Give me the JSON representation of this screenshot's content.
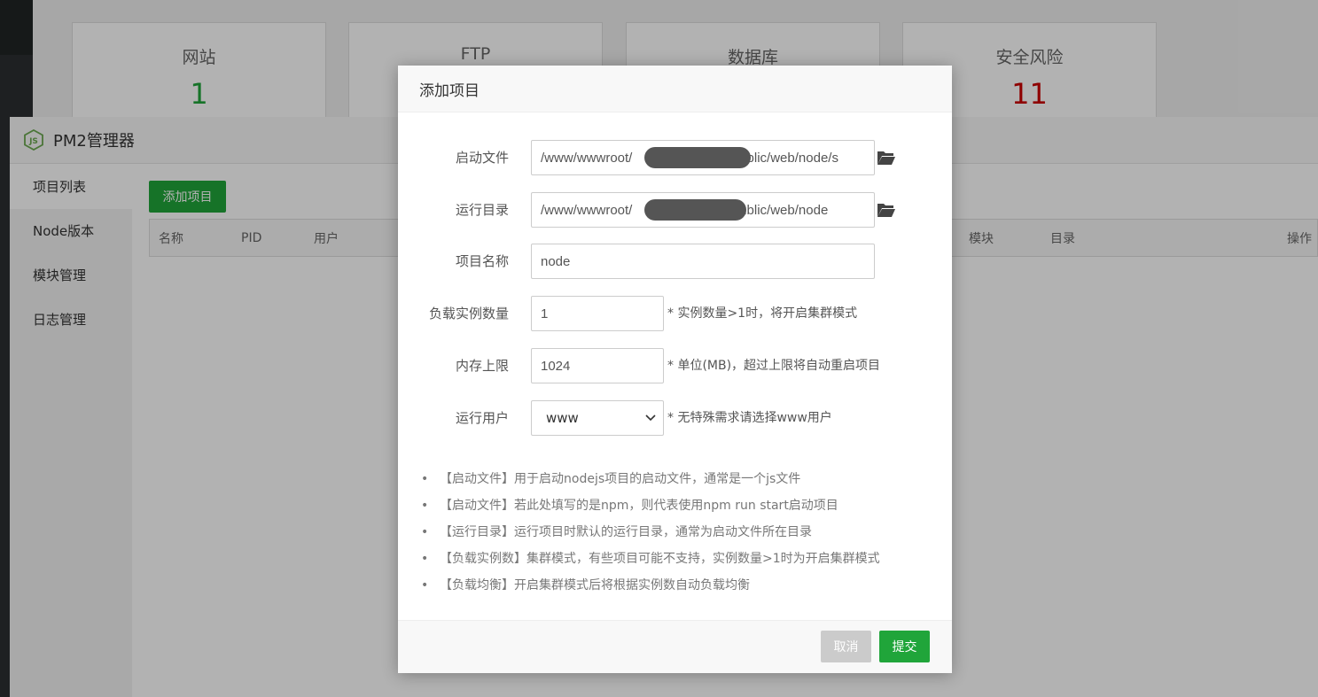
{
  "stats": [
    {
      "label": "网站",
      "value": "1"
    },
    {
      "label": "FTP",
      "value": ""
    },
    {
      "label": "数据库",
      "value": ""
    },
    {
      "label": "安全风险",
      "value": "11"
    }
  ],
  "pm2": {
    "title": "PM2管理器",
    "sidebar": [
      "项目列表",
      "Node版本",
      "模块管理",
      "日志管理"
    ],
    "add_button": "添加项目",
    "columns": [
      "名称",
      "PID",
      "用户",
      "模块",
      "目录",
      "操作"
    ]
  },
  "modal": {
    "title": "添加项目",
    "fields": {
      "start_file": {
        "label": "启动文件",
        "value": "/www/wwwroot/                          /public/web/node/s"
      },
      "run_dir": {
        "label": "运行目录",
        "value": "/www/wwwroot/                          /public/web/node"
      },
      "project_name": {
        "label": "项目名称",
        "value": "node"
      },
      "instances": {
        "label": "负载实例数量",
        "value": "1",
        "hint": "* 实例数量>1时，将开启集群模式"
      },
      "memory": {
        "label": "内存上限",
        "value": "1024",
        "hint": "* 单位(MB)，超过上限将自动重启项目"
      },
      "user": {
        "label": "运行用户",
        "value": "www",
        "hint": "* 无特殊需求请选择www用户"
      }
    },
    "tips": [
      "【启动文件】用于启动nodejs项目的启动文件，通常是一个js文件",
      "【启动文件】若此处填写的是npm，则代表使用npm run start启动项目",
      "【运行目录】运行项目时默认的运行目录，通常为启动文件所在目录",
      "【负载实例数】集群模式，有些项目可能不支持，实例数量>1时为开启集群模式",
      "【负载均衡】开启集群模式后将根据实例数自动负载均衡"
    ],
    "cancel": "取消",
    "submit": "提交"
  },
  "colors": {
    "accent": "#20a53a",
    "risk": "#cc0000"
  }
}
